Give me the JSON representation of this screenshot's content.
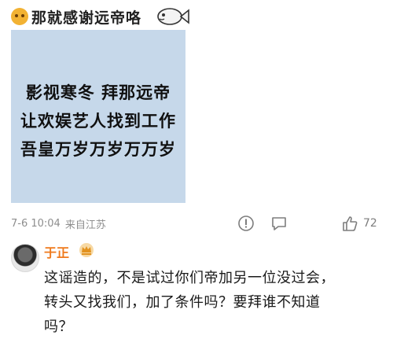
{
  "post": {
    "text": "那就感谢远帝咯",
    "image_lines": [
      "影视寒冬  拜那远帝",
      "让欢娱艺人找到工作",
      "吾皇万岁万岁万万岁"
    ],
    "time": "7-6 10:04",
    "location": "来自江苏",
    "like_count": "72"
  },
  "comment": {
    "author": "于正",
    "lines": [
      "这谣造的，不是试过你们帝加另一位没过会，",
      "转头又找我们，加了条件吗？要拜谁不知道",
      "吗？"
    ]
  },
  "icons": {
    "emoji": "grinning-emoji-icon",
    "fish": "fish-sticker-icon",
    "report": "alert-icon",
    "comment": "comment-icon",
    "like": "thumbs-up-icon",
    "vip": "vip-crown-icon"
  }
}
